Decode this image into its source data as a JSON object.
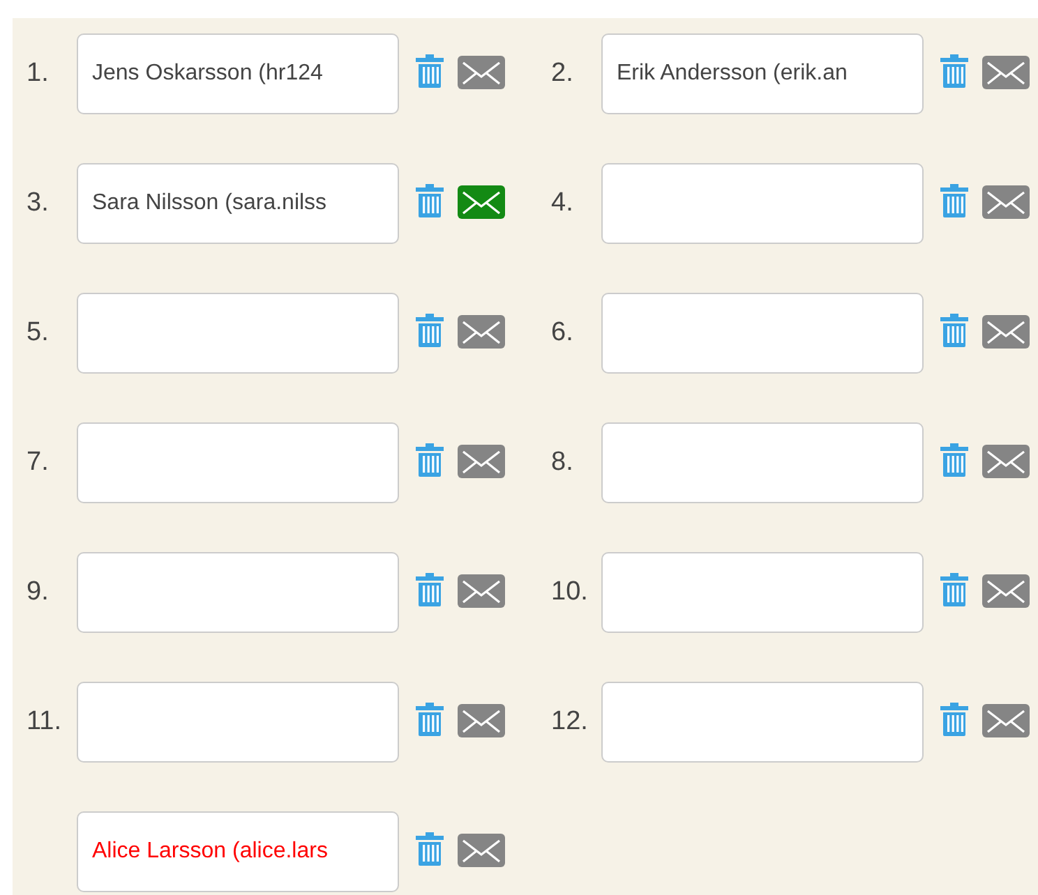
{
  "recipients": [
    {
      "number": "1.",
      "value": "Jens Oskarsson (hr124",
      "mail_sent": false,
      "invalid": false
    },
    {
      "number": "2.",
      "value": "Erik Andersson (erik.an",
      "mail_sent": false,
      "invalid": false
    },
    {
      "number": "3.",
      "value": "Sara Nilsson (sara.nilss",
      "mail_sent": true,
      "invalid": false
    },
    {
      "number": "4.",
      "mail_sent": false
    },
    {
      "number": "5.",
      "mail_sent": false
    },
    {
      "number": "6.",
      "mail_sent": false
    },
    {
      "number": "7.",
      "mail_sent": false
    },
    {
      "number": "8.",
      "mail_sent": false
    },
    {
      "number": "9.",
      "mail_sent": false
    },
    {
      "number": "10.",
      "mail_sent": false
    },
    {
      "number": "11.",
      "mail_sent": false
    },
    {
      "number": "12.",
      "mail_sent": false
    },
    {
      "value": "Alice Larsson (alice.lars",
      "mail_sent": false,
      "invalid": true
    }
  ]
}
